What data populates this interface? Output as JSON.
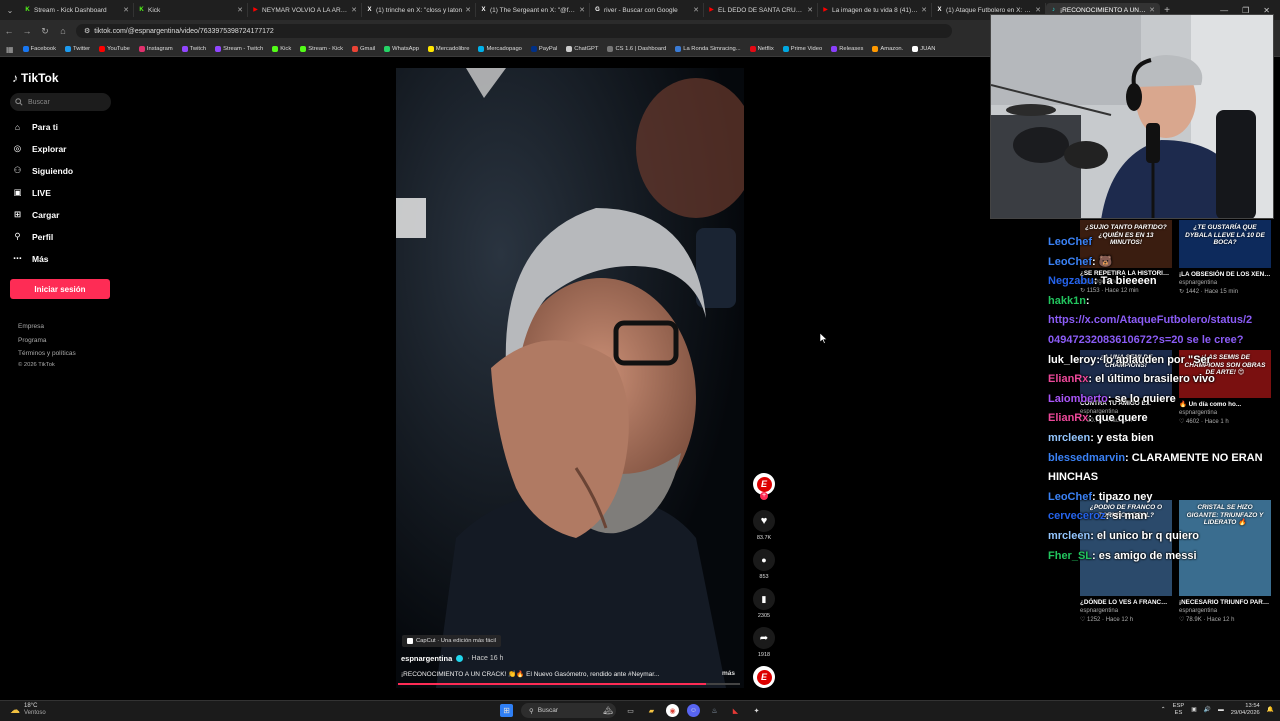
{
  "browser": {
    "tabs": [
      {
        "title": "Stream - Kick Dashboard",
        "color": "#53fc18",
        "glyph": "K"
      },
      {
        "title": "Kick",
        "color": "#53fc18",
        "glyph": "K"
      },
      {
        "title": "NEYMAR VOLVIÓ A LA ARGE",
        "color": "#ff0000",
        "glyph": "▶"
      },
      {
        "title": "(1) trinche en X: \"closs y laton",
        "color": "#ffffff",
        "glyph": "X"
      },
      {
        "title": "(1) The Sergeant en X: \"@frfalt",
        "color": "#ffffff",
        "glyph": "X"
      },
      {
        "title": "river - Buscar con Google",
        "color": "#ffffff",
        "glyph": "G"
      },
      {
        "title": "EL DEDO DE SANTA CRUZ A N",
        "color": "#ff0000",
        "glyph": "▶"
      },
      {
        "title": "La imagen de tu vida 8 (41) M",
        "color": "#ff0000",
        "glyph": "▶"
      },
      {
        "title": "(1) Ataque Futbolero en X: \"Ar",
        "color": "#ffffff",
        "glyph": "X"
      },
      {
        "title": "¡RECONOCIMIENTO A UN CR",
        "color": "#25f4ee",
        "glyph": "♪",
        "active": true
      }
    ],
    "url": "tiktok.com/@espnargentina/video/7633975398724177172",
    "bookmarks": [
      {
        "label": "Facebook",
        "color": "#1877f2"
      },
      {
        "label": "Twitter",
        "color": "#1d9bf0"
      },
      {
        "label": "YouTube",
        "color": "#ff0000"
      },
      {
        "label": "Instagram",
        "color": "#e1306c"
      },
      {
        "label": "Twitch",
        "color": "#9146ff"
      },
      {
        "label": "Stream - Twitch",
        "color": "#9146ff"
      },
      {
        "label": "Kick",
        "color": "#53fc18"
      },
      {
        "label": "Stream - Kick",
        "color": "#53fc18"
      },
      {
        "label": "Gmail",
        "color": "#ea4335"
      },
      {
        "label": "WhatsApp",
        "color": "#25d366"
      },
      {
        "label": "Mercadolibre",
        "color": "#ffe600"
      },
      {
        "label": "Mercadopago",
        "color": "#00b1ea"
      },
      {
        "label": "PayPal",
        "color": "#003087"
      },
      {
        "label": "ChatGPT",
        "color": "#cccccc"
      },
      {
        "label": "CS 1.6 | Dashboard",
        "color": "#777777"
      },
      {
        "label": "La Ronda Simracing...",
        "color": "#3a7bd5"
      },
      {
        "label": "Netflix",
        "color": "#e50914"
      },
      {
        "label": "Prime Video",
        "color": "#00a8e1"
      },
      {
        "label": "Releases",
        "color": "#8a3ffc"
      },
      {
        "label": "Amazon.",
        "color": "#ff9900"
      },
      {
        "label": "JUAN",
        "color": "#ffffff"
      }
    ]
  },
  "tiktok": {
    "logo": "TikTok",
    "search_placeholder": "Buscar",
    "nav": [
      {
        "label": "Para ti",
        "icon": "home-icon"
      },
      {
        "label": "Explorar",
        "icon": "compass-icon"
      },
      {
        "label": "Siguiendo",
        "icon": "users-icon"
      },
      {
        "label": "LIVE",
        "icon": "live-icon"
      },
      {
        "label": "Cargar",
        "icon": "upload-icon"
      },
      {
        "label": "Perfil",
        "icon": "profile-icon"
      },
      {
        "label": "Más",
        "icon": "more-icon"
      }
    ],
    "login_button": "Iniciar sesión",
    "footer": {
      "company": "Empresa",
      "program": "Programa",
      "terms": "Términos y políticas",
      "copyright": "© 2026 TikTok"
    },
    "video": {
      "capcut": "CapCut · Una edición más fácil",
      "author": "espnargentina",
      "time_ago": "· Hace 16 h",
      "caption": "¡RECONOCIMIENTO A UN CRACK! 👏🔥 El Nuevo Gasómetro, rendido ante #Neymar...",
      "more": "más",
      "progress": 0.9
    },
    "actions": {
      "likes": "83.7K",
      "comments": "853",
      "saves": "2305",
      "shares": "1918"
    }
  },
  "thumbnails": [
    {
      "overlay": "¿SUJIO TANTO PARTIDO? ¿QUIÉN ES EN 13 MINUTOS!",
      "title": "¿SE REPETIRÁ LA HISTORIA? ...",
      "channel": "espnargentina",
      "stats": "↻ 1153 · Hace 12 min",
      "bg": "#3a1d10"
    },
    {
      "overlay": "¿TE GUSTARÍA QUE DYBALA LLEVE LA 10 DE BOCA?",
      "title": "¡LA OBSESIÓN DE LOS XENEIZES! 🔥🇦🇷 Los...",
      "channel": "espnargentina",
      "stats": "↻ 1442 · Hace 15 min",
      "bg": "#0d2a5c"
    },
    {
      "overlay": "¿A UNA SEMI DE CHAMPIONS!",
      "title": "CONTRA TU AMIGO E...",
      "channel": "espnargentina",
      "stats": "♡ 20.7K · Hace 1 h",
      "bg": "#1b2a4a"
    },
    {
      "overlay": "¿LAS SEMIS DE CHAMPIONS SON OBRAS DE ARTE! 😍",
      "title": "🔥 Un día como ho...",
      "channel": "espnargentina",
      "stats": "♡ 4602 · Hace 1 h",
      "bg": "#7a1010"
    },
    {
      "overlay": "¿PODIO DE FRANCO O TORNEO LOCAL?",
      "title": "¿DÓNDE LO VES A FRANCO? 🤔 Junto...",
      "channel": "espnargentina",
      "stats": "♡ 1252 · Hace 12 h",
      "bg": "#2b4a6b"
    },
    {
      "overlay": "CRISTAL SE HIZO GIGANTE: TRIUNFAZO Y LIDERATO 🔥",
      "title": "¡NECESARIO TRIUNFO PARA LIDERAR! 🏃🔥 ...",
      "channel": "espnargentina",
      "stats": "♡ 78.9K · Hace 12 h",
      "bg": "#3a6d8f"
    }
  ],
  "chat": [
    {
      "user": "LeoChef",
      "color": "#3b82f6",
      "msg": ""
    },
    {
      "user": "LeoChef",
      "color": "#3b82f6",
      "msg": ": 🐻"
    },
    {
      "user": "Negzabu",
      "color": "#2563eb",
      "msg": ": Ta bieeeen"
    },
    {
      "user": "hakk1n",
      "color": "#22c55e",
      "msg": ":"
    },
    {
      "user": "",
      "color": "#8b5cf6",
      "msg": "https://x.com/AtaqueFutbolero/status/2"
    },
    {
      "user": "",
      "color": "#8b5cf6",
      "msg": "04947232083610672?s=20 se le cree?"
    },
    {
      "user": "luk_leroy",
      "color": "#ffffff",
      "msg": ": lo aplauden por \"Ser"
    },
    {
      "user": "ElianRx",
      "color": "#ec4899",
      "msg": ": el último brasilero vivo"
    },
    {
      "user": "Laiomberto",
      "color": "#a855f7",
      "msg": ": se lo quiere"
    },
    {
      "user": "ElianRx",
      "color": "#ec4899",
      "msg": ": que quere"
    },
    {
      "user": "mrcleen",
      "color": "#93c5fd",
      "msg": ": y esta bien"
    },
    {
      "user": "blessedmarvin",
      "color": "#3b82f6",
      "msg": ": CLARAMENTE NO ERAN"
    },
    {
      "user": "",
      "color": "#ffffff",
      "msg": "HINCHAS"
    },
    {
      "user": "LeoChef",
      "color": "#3b82f6",
      "msg": ": tipazo ney"
    },
    {
      "user": "cerveceroz",
      "color": "#2563eb",
      "msg": ": si man"
    },
    {
      "user": "mrcleen",
      "color": "#93c5fd",
      "msg": ": el unico br q quiero"
    },
    {
      "user": "Fher_SL",
      "color": "#22c55e",
      "msg": ": es amigo de messi"
    }
  ],
  "taskbar": {
    "temp": "18°C",
    "weather": "Ventoso",
    "search": "Buscar",
    "lang": "ESP",
    "lang_sub": "ES",
    "time": "13:54",
    "date": "29/04/2026"
  }
}
